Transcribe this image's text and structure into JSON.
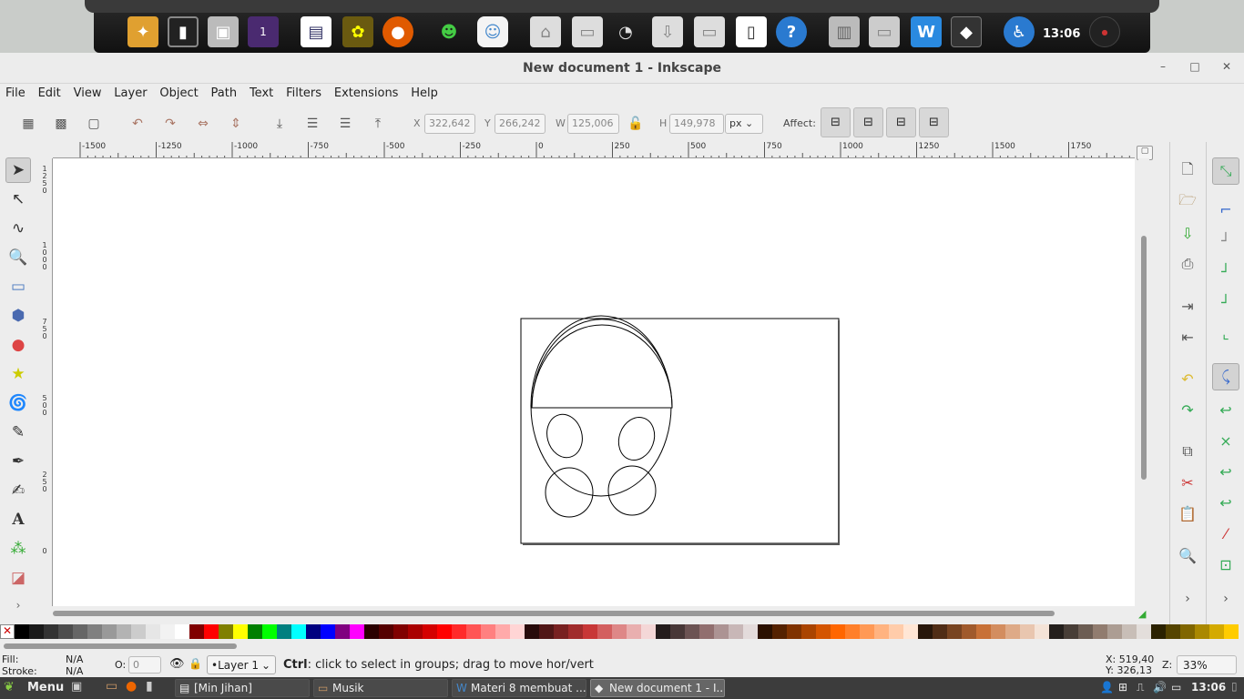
{
  "dock": {
    "clock": "13:06",
    "icons": [
      "app-icon",
      "terminal-icon",
      "package-icon",
      "workspace-icon",
      "image-viewer-icon",
      "photos-icon",
      "firefox-icon",
      "game-icon",
      "chat-icon",
      "home-folder-icon",
      "folder-icon",
      "clock-app-icon",
      "downloads-folder-icon",
      "documents-folder-icon",
      "phone-icon",
      "help-icon",
      "cabinet-icon",
      "folder-icon",
      "wps-icon",
      "inkscape-icon",
      "accessibility-icon"
    ],
    "workspace_number": "1"
  },
  "window": {
    "title": "New document 1 - Inkscape",
    "minimize": "–",
    "maximize": "□",
    "close": "✕"
  },
  "menu": [
    "File",
    "Edit",
    "View",
    "Layer",
    "Object",
    "Path",
    "Text",
    "Filters",
    "Extensions",
    "Help"
  ],
  "toolbar": {
    "x_label": "X",
    "x_value": "322,642",
    "y_label": "Y",
    "y_value": "266,242",
    "w_label": "W",
    "w_value": "125,006",
    "h_label": "H",
    "h_value": "149,978",
    "unit": "px",
    "affect_label": "Affect:"
  },
  "ruler": {
    "h_ticks": [
      "-1500",
      "-1250",
      "-1000",
      "-750",
      "-500",
      "-250",
      "0",
      "250",
      "500",
      "750",
      "1000",
      "1250",
      "1500",
      "1750",
      "2"
    ],
    "v_ticks": [
      "1\n2\n5\n0",
      "1\n0\n0\n0",
      "7\n5\n0",
      "5\n0\n0",
      "2\n5\n0",
      "0"
    ]
  },
  "palette": [
    "#000000",
    "#1a1a1a",
    "#333333",
    "#4d4d4d",
    "#666666",
    "#808080",
    "#999999",
    "#b3b3b3",
    "#cccccc",
    "#e6e6e6",
    "#f2f2f2",
    "#ffffff",
    "#800000",
    "#ff0000",
    "#808000",
    "#ffff00",
    "#008000",
    "#00ff00",
    "#008080",
    "#00ffff",
    "#000080",
    "#0000ff",
    "#800080",
    "#ff00ff",
    "#2b0000",
    "#550000",
    "#800000",
    "#aa0000",
    "#d40000",
    "#ff0000",
    "#ff2a2a",
    "#ff5555",
    "#ff8080",
    "#ffaaaa",
    "#ffd5d5",
    "#280b0b",
    "#501616",
    "#782121",
    "#a02c2c",
    "#c83737",
    "#d35f5f",
    "#de8787",
    "#e9afaf",
    "#f4d7d7",
    "#241c1c",
    "#483737",
    "#6c5353",
    "#916f6f",
    "#ac9393",
    "#c8b7b7",
    "#e3dbdb",
    "#2b1100",
    "#552200",
    "#803300",
    "#aa4400",
    "#d45500",
    "#ff6600",
    "#ff7f2a",
    "#ff9955",
    "#ffb380",
    "#ffccaa",
    "#ffe6d5",
    "#28170b",
    "#502d16",
    "#784421",
    "#a05a2c",
    "#c87137",
    "#d38d5f",
    "#deaa87",
    "#e9c6af",
    "#f4e3d7",
    "#241f1c",
    "#483e37",
    "#6c5d53",
    "#917c6f",
    "#ac9d93",
    "#c8beb7",
    "#e3dedb",
    "#2b2200",
    "#554400",
    "#806600",
    "#aa8800",
    "#d4aa00",
    "#ffcc00"
  ],
  "status": {
    "fill_label": "Fill:",
    "fill_value": "N/A",
    "stroke_label": "Stroke:",
    "stroke_value": "N/A",
    "opacity_label": "O:",
    "opacity_value": "0",
    "layer": "•Layer 1",
    "message_key": "Ctrl",
    "message": ": click to select in groups; drag to move hor/vert",
    "x_coord": "X: 519,40",
    "y_coord": "Y: 326,13",
    "zoom_label": "Z:",
    "zoom": "33%"
  },
  "taskbar": {
    "menu_label": "Menu",
    "tasks": [
      "[Min Jihan]",
      "Musik",
      "Materi 8 membuat ...",
      "New document 1 - I..."
    ],
    "clock": "13:06"
  }
}
